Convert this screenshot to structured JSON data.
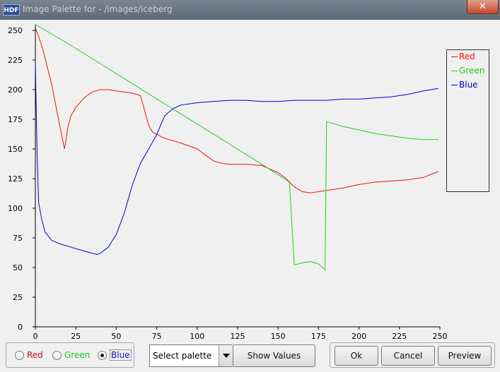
{
  "window": {
    "app_icon": "HDF",
    "title": "Image Palette for - /images/iceberg",
    "close_glyph": "✕"
  },
  "chart_data": {
    "type": "line",
    "xlim": [
      0,
      250
    ],
    "ylim": [
      0,
      250
    ],
    "xticks": [
      0,
      25,
      50,
      75,
      100,
      125,
      150,
      175,
      200,
      225,
      250
    ],
    "yticks": [
      0,
      25,
      50,
      75,
      100,
      125,
      150,
      175,
      200,
      225,
      250
    ],
    "grid": false,
    "legend_position": "top-right",
    "series": [
      {
        "name": "Red",
        "color": "#ee1111",
        "x": [
          0,
          2,
          5,
          10,
          15,
          18,
          19,
          20,
          22,
          25,
          30,
          35,
          40,
          45,
          50,
          55,
          60,
          65,
          70,
          72,
          74,
          76,
          78,
          80,
          90,
          100,
          110,
          115,
          120,
          130,
          140,
          150,
          155,
          160,
          165,
          170,
          175,
          180,
          190,
          200,
          210,
          220,
          230,
          240,
          249
        ],
        "values": [
          252,
          245,
          232,
          205,
          170,
          150,
          158,
          168,
          178,
          185,
          193,
          198,
          200,
          200,
          199,
          198,
          197,
          195,
          170,
          165,
          163,
          162,
          160,
          159,
          155,
          150,
          140,
          138,
          137,
          137,
          136,
          130,
          125,
          118,
          114,
          113,
          114,
          115,
          117,
          120,
          122,
          123,
          124,
          126,
          131
        ]
      },
      {
        "name": "Green",
        "color": "#22cc22",
        "x": [
          0,
          10,
          20,
          40,
          60,
          80,
          100,
          120,
          140,
          157,
          160,
          165,
          170,
          175,
          179,
          180,
          185,
          190,
          200,
          210,
          220,
          230,
          240,
          249
        ],
        "values": [
          255,
          247,
          239,
          222,
          205,
          188,
          171,
          154,
          137,
          122,
          52,
          54,
          55,
          53,
          48,
          173,
          171,
          169,
          166,
          163,
          161,
          159,
          158,
          158
        ]
      },
      {
        "name": "Blue",
        "color": "#0000cc",
        "x": [
          0,
          1,
          2,
          4,
          6,
          10,
          15,
          20,
          25,
          30,
          35,
          38,
          40,
          45,
          50,
          55,
          60,
          65,
          70,
          75,
          78,
          80,
          85,
          90,
          100,
          110,
          120,
          130,
          140,
          150,
          160,
          170,
          180,
          190,
          200,
          210,
          220,
          230,
          240,
          249
        ],
        "values": [
          222,
          150,
          105,
          90,
          80,
          73,
          70,
          68,
          66,
          64,
          62,
          61,
          62,
          67,
          78,
          96,
          120,
          138,
          150,
          162,
          172,
          178,
          184,
          187,
          189,
          190,
          191,
          191,
          190,
          190,
          191,
          191,
          191,
          192,
          192,
          193,
          194,
          196,
          199,
          201
        ]
      }
    ]
  },
  "controls": {
    "channels": [
      {
        "label": "Red",
        "color": "#d01010",
        "checked": false
      },
      {
        "label": "Green",
        "color": "#20c020",
        "checked": false
      },
      {
        "label": "Blue",
        "color": "#1010d0",
        "checked": true
      }
    ],
    "select_palette": "Select palette",
    "show_values": "Show Values",
    "ok": "Ok",
    "cancel": "Cancel",
    "preview": "Preview"
  }
}
